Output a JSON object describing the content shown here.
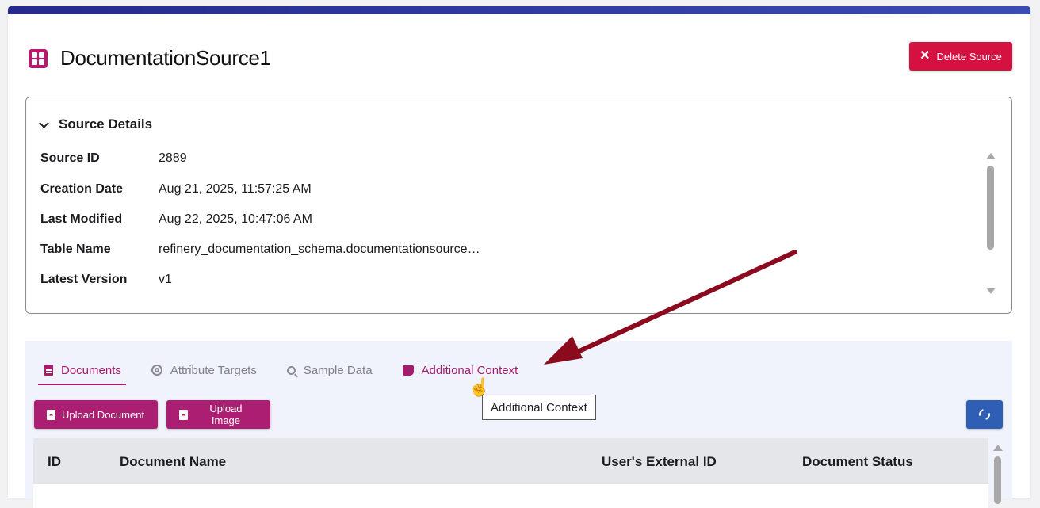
{
  "header": {
    "title": "DocumentationSource1",
    "delete_label": "Delete Source"
  },
  "details": {
    "heading": "Source Details",
    "rows": [
      {
        "label": "Source ID",
        "value": "2889"
      },
      {
        "label": "Creation Date",
        "value": "Aug 21, 2025, 11:57:25 AM"
      },
      {
        "label": "Last Modified",
        "value": "Aug 22, 2025, 10:47:06 AM"
      },
      {
        "label": "Table Name",
        "value": "refinery_documentation_schema.documentationsource…"
      },
      {
        "label": "Latest Version",
        "value": "v1"
      }
    ]
  },
  "tabs": [
    {
      "label": "Documents",
      "icon": "document-icon",
      "active": true
    },
    {
      "label": "Attribute Targets",
      "icon": "target-icon"
    },
    {
      "label": "Sample Data",
      "icon": "search-data-icon"
    },
    {
      "label": "Additional Context",
      "icon": "note-icon",
      "hovered": true
    }
  ],
  "toolbar": {
    "upload_document": "Upload Document",
    "upload_image": "Upload Image"
  },
  "tooltip": "Additional Context",
  "table": {
    "columns": [
      "ID",
      "Document Name",
      "User's External ID",
      "Document Status"
    ]
  },
  "colors": {
    "accent": "#a51c6d",
    "danger": "#d41140",
    "primary": "#2f5fb5",
    "annotation_arrow": "#8b0a1e"
  }
}
